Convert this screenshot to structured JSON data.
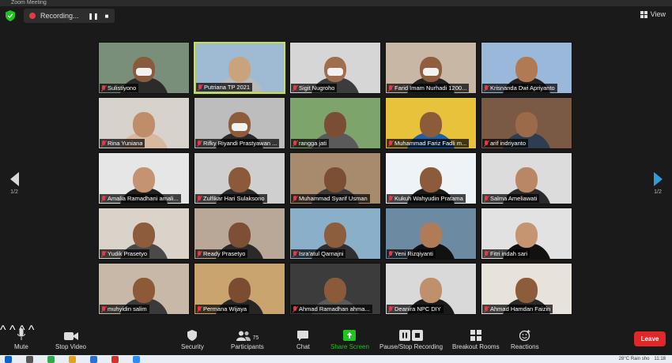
{
  "window": {
    "title": "Zoom Meeting"
  },
  "recording": {
    "label": "Recording...",
    "pause_icon": "pause-icon",
    "stop_icon": "stop-icon"
  },
  "view": {
    "label": "View",
    "icon": "grid-icon"
  },
  "pagination": {
    "left": "1/2",
    "right": "1/2"
  },
  "participants": [
    {
      "name": "Sulistiyono",
      "bg": "#7a8f7a",
      "skin": "#8a5a3c",
      "shirt": "#2b2b2b",
      "mask": true,
      "active": false
    },
    {
      "name": "Putriana TP 2021",
      "bg": "#9fbad3",
      "skin": "#c9a27e",
      "shirt": "#b9b9b9",
      "mask": false,
      "active": true
    },
    {
      "name": "Sigit Nugroho",
      "bg": "#d6d6d6",
      "skin": "#a06e4d",
      "shirt": "#3c3c3c",
      "mask": true,
      "active": false
    },
    {
      "name": "Farid Imam Nurhadi 1200...",
      "bg": "#c9b7a6",
      "skin": "#8e5e3e",
      "shirt": "#222222",
      "mask": true,
      "active": false
    },
    {
      "name": "Krisnanda Dwi Apriyanto",
      "bg": "#9ab8d9",
      "skin": "#b07a54",
      "shirt": "#222222",
      "mask": false,
      "active": false
    },
    {
      "name": "Rina Yuniana",
      "bg": "#d8d2cc",
      "skin": "#c08d6a",
      "shirt": "#d7b9a0",
      "mask": false,
      "active": false
    },
    {
      "name": "Rifky Riyandi Prastyawan ...",
      "bg": "#bdbdbd",
      "skin": "#8d5c3b",
      "shirt": "#2a2a2a",
      "mask": true,
      "active": false
    },
    {
      "name": "rangga jati",
      "bg": "#7da46b",
      "skin": "#7a4e34",
      "shirt": "#5a5a5a",
      "mask": false,
      "active": false
    },
    {
      "name": "Muhammad Fariz Fadli m...",
      "bg": "#e8c23b",
      "skin": "#8c5b3a",
      "shirt": "#1e5fa6",
      "mask": false,
      "active": false
    },
    {
      "name": "arif indriyanto",
      "bg": "#7a5a44",
      "skin": "#9b6a48",
      "shirt": "#2c3e50",
      "mask": false,
      "active": false
    },
    {
      "name": "Amalia Ramadhani amali...",
      "bg": "#e6e6e6",
      "skin": "#c49371",
      "shirt": "#1f1f1f",
      "mask": false,
      "active": false
    },
    {
      "name": "Zulfikar Hari Sulaksono",
      "bg": "#cfcfcf",
      "skin": "#8a5a3a",
      "shirt": "#2b2b2b",
      "mask": false,
      "active": false
    },
    {
      "name": "Muhammad Syarif Usman",
      "bg": "#a88a6c",
      "skin": "#7b4f33",
      "shirt": "#3a3a3a",
      "mask": false,
      "active": false
    },
    {
      "name": "Kukuh Wahyudin Pratama",
      "bg": "#eef3f8",
      "skin": "#8b5b3b",
      "shirt": "#1a1a1a",
      "mask": false,
      "active": false
    },
    {
      "name": "Salma Ameliawati",
      "bg": "#dcdcdc",
      "skin": "#b98765",
      "shirt": "#2b2b2b",
      "mask": false,
      "active": false
    },
    {
      "name": "Yudik Prasetyo",
      "bg": "#d9d3c9",
      "skin": "#8c5c3c",
      "shirt": "#4a4a4a",
      "mask": false,
      "active": false
    },
    {
      "name": "Ready Prasetyo",
      "bg": "#b9a898",
      "skin": "#7c5035",
      "shirt": "#2a2a2a",
      "mask": false,
      "active": false
    },
    {
      "name": "Isra'atul Qarnajni",
      "bg": "#8ab0c9",
      "skin": "#8c5e3e",
      "shirt": "#2f2f2f",
      "mask": false,
      "active": false
    },
    {
      "name": "Yeni Rizqiyanti",
      "bg": "#6d8aa3",
      "skin": "#b07c58",
      "shirt": "#111111",
      "mask": false,
      "active": false
    },
    {
      "name": "Fitri indah sari",
      "bg": "#e2e2e2",
      "skin": "#c59572",
      "shirt": "#111111",
      "mask": false,
      "active": false
    },
    {
      "name": "muhyidin salim",
      "bg": "#c7b8a8",
      "skin": "#8c5a39",
      "shirt": "#3a3a3a",
      "mask": false,
      "active": false
    },
    {
      "name": "Permana Wijaya",
      "bg": "#c9a46e",
      "skin": "#7a4d31",
      "shirt": "#262626",
      "mask": false,
      "active": false
    },
    {
      "name": "Ahmad Ramadhan ahma...",
      "bg": "#3c3c3c",
      "skin": "#8a5a3a",
      "shirt": "#5a5a5a",
      "mask": false,
      "active": false
    },
    {
      "name": "Deanira NPC DIY",
      "bg": "#d9d9d9",
      "skin": "#c08f6b",
      "shirt": "#1a1a1a",
      "mask": false,
      "active": false
    },
    {
      "name": "Ahmad Hamdan Faizin",
      "bg": "#e7e2da",
      "skin": "#8d5c3b",
      "shirt": "#2a2a2a",
      "mask": false,
      "active": false
    }
  ],
  "toolbar": {
    "mute": "Mute",
    "stop_video": "Stop Video",
    "security": "Security",
    "participants": "Participants",
    "participants_count": "75",
    "chat": "Chat",
    "share_screen": "Share Screen",
    "pause_recording": "Pause/Stop Recording",
    "breakout": "Breakout Rooms",
    "reactions": "Reactions",
    "leave": "Leave"
  },
  "taskbar": {
    "weather": "28°C  Rain sho",
    "clock": "11:18"
  },
  "colors": {
    "accent_green": "#1ec51e",
    "leave_red": "#e02828",
    "active_border": "#c7e23a",
    "mic_off_red": "#e63946",
    "nav_blue": "#2d9cdb"
  }
}
